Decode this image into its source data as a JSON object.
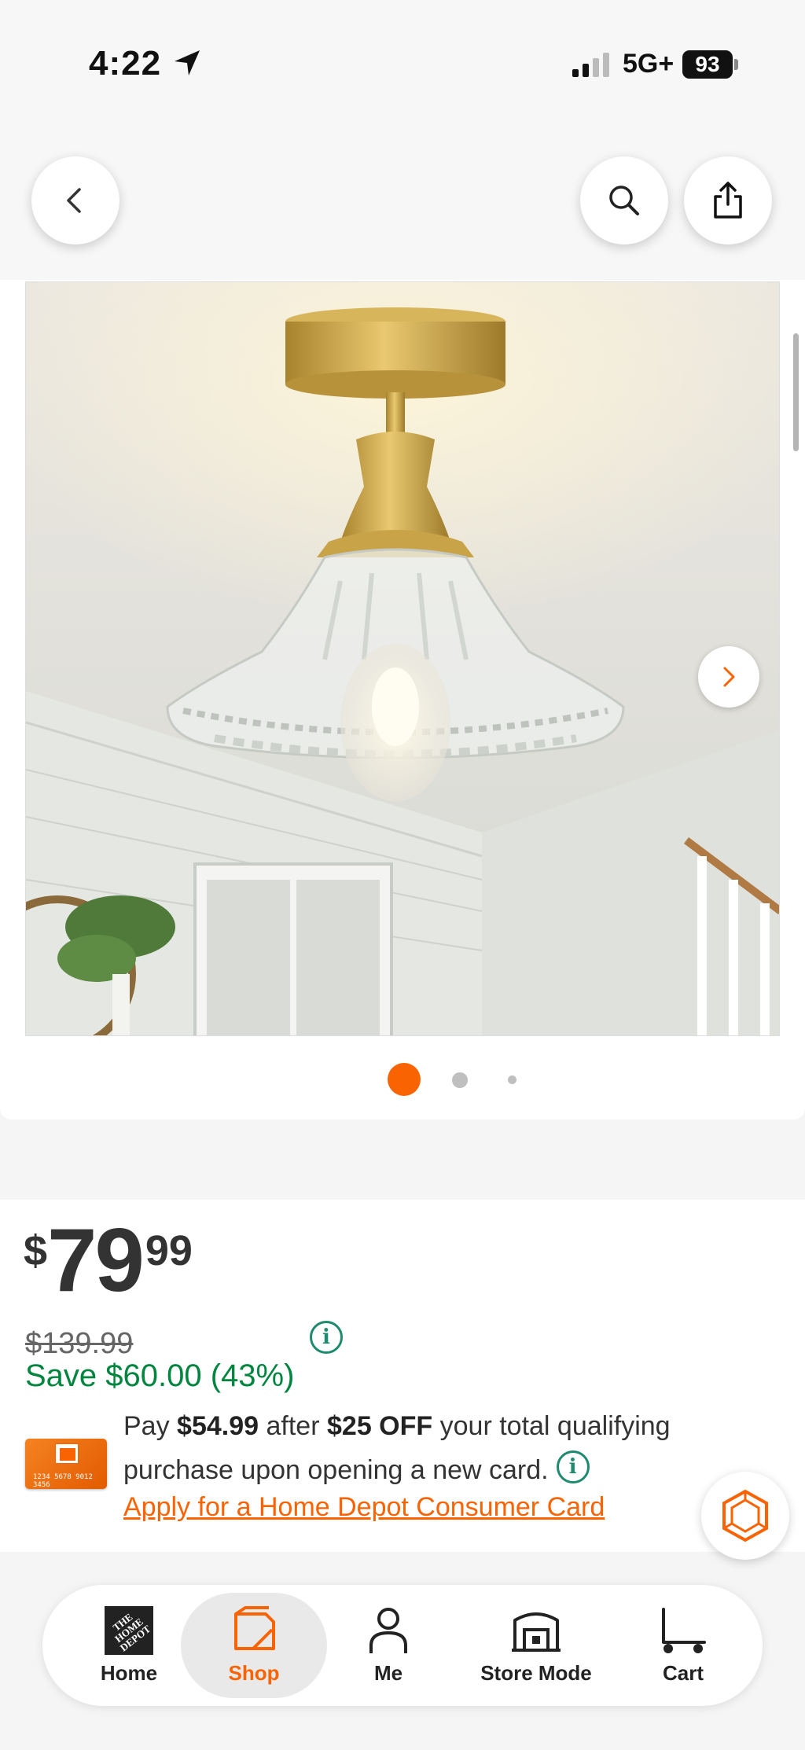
{
  "status_bar": {
    "time": "4:22",
    "network": "5G+",
    "battery": "93"
  },
  "header": {
    "icons": [
      "back-icon",
      "search-icon",
      "share-icon"
    ]
  },
  "gallery": {
    "image_description_icon": "ceiling-light-product-image",
    "dots_total": 3,
    "active_dot": 1
  },
  "price": {
    "currency": "$",
    "whole": "79",
    "cents": "99",
    "was_price": "$139.99",
    "savings": "Save $60.00 (43%)"
  },
  "offer": {
    "pay_word": "Pay",
    "pay_amount": "$54.99",
    "after_word": "after",
    "discount": "$25 OFF",
    "rest_line1": "your total qualifying",
    "rest_line2": "purchase upon opening a new card.",
    "apply_link": "Apply for a Home Depot Consumer Card",
    "card_number": "1234 5678 9012 3456"
  },
  "nav": {
    "home_logo": "THE HOME DEPOT",
    "home": "Home",
    "shop": "Shop",
    "me": "Me",
    "store_mode": "Store Mode",
    "cart": "Cart"
  },
  "colors": {
    "accent": "#f96302",
    "save_green": "#00853f",
    "info_teal": "#1e8a6e"
  }
}
